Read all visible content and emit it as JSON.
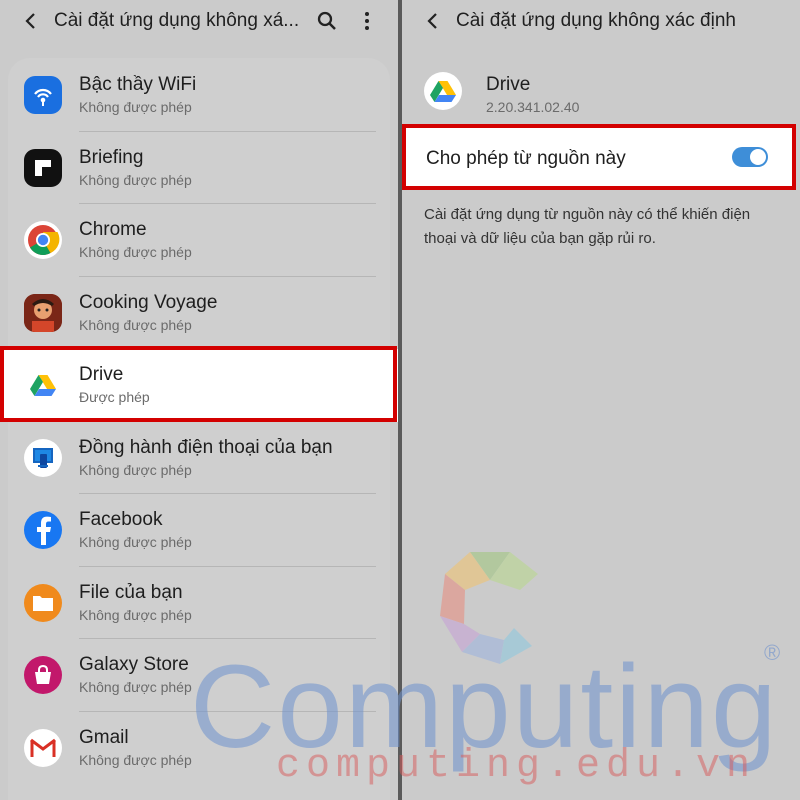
{
  "left": {
    "header": {
      "title": "Cài đặt ứng dụng không xá..."
    },
    "apps": [
      {
        "name": "Bậc thầy WiFi",
        "status": "Không được phép",
        "icon": "wifi-master-icon",
        "color": "#1a6fe0"
      },
      {
        "name": "Briefing",
        "status": "Không được phép",
        "icon": "briefing-icon",
        "color": "#111111"
      },
      {
        "name": "Chrome",
        "status": "Không được phép",
        "icon": "chrome-icon",
        "color": "#ffffff"
      },
      {
        "name": "Cooking Voyage",
        "status": "Không được phép",
        "icon": "cooking-voyage-icon",
        "color": "#8a2a1a"
      },
      {
        "name": "Drive",
        "status": "Được phép",
        "icon": "google-drive-icon",
        "color": "#ffffff"
      },
      {
        "name": "Đồng hành điện thoại của bạn",
        "status": "Không được phép",
        "icon": "phone-companion-icon",
        "color": "#ffffff"
      },
      {
        "name": "Facebook",
        "status": "Không được phép",
        "icon": "facebook-icon",
        "color": "#1877f2"
      },
      {
        "name": "File của bạn",
        "status": "Không được phép",
        "icon": "my-files-icon",
        "color": "#f08a1c"
      },
      {
        "name": "Galaxy Store",
        "status": "Không được phép",
        "icon": "galaxy-store-icon",
        "color": "#c2186b"
      },
      {
        "name": "Gmail",
        "status": "Không được phép",
        "icon": "gmail-icon",
        "color": "#ffffff"
      }
    ]
  },
  "right": {
    "header": {
      "title": "Cài đặt ứng dụng không xác định"
    },
    "app": {
      "name": "Drive",
      "version": "2.20.341.02.40"
    },
    "toggle": {
      "label": "Cho phép từ nguồn này",
      "on": true,
      "color": "#3e8ed8"
    },
    "warning": "Cài đặt ứng dụng từ nguồn này có thể khiến điện thoại và dữ liệu của bạn gặp rủi ro."
  },
  "watermark": {
    "brand": "Computing",
    "reg": "®",
    "url": "computing.edu.vn"
  },
  "colors": {
    "highlight": "#d30000",
    "background": "#cbcbcb"
  }
}
